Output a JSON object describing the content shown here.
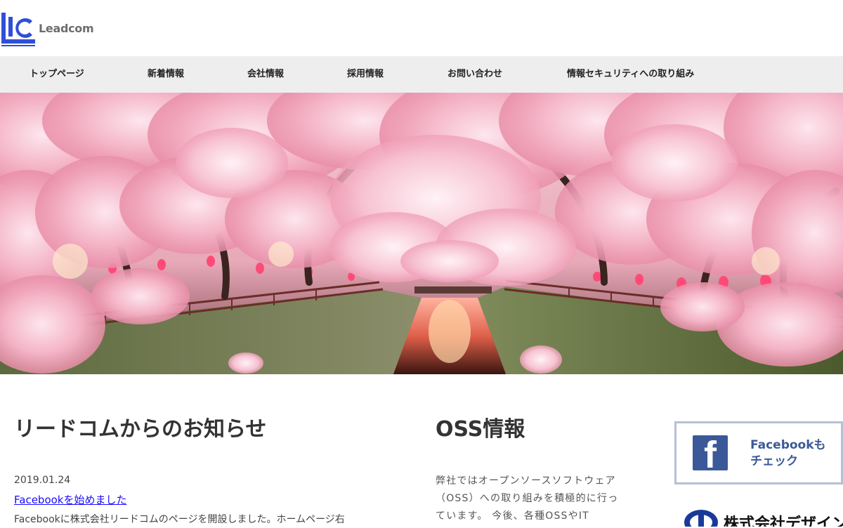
{
  "header": {
    "logo_text": "Leadcom"
  },
  "nav": {
    "items": [
      {
        "label": "トップページ"
      },
      {
        "label": "新着情報"
      },
      {
        "label": "会社情報"
      },
      {
        "label": "採用情報"
      },
      {
        "label": "お問い合わせ"
      },
      {
        "label": "情報セキュリティへの取り組み"
      }
    ]
  },
  "news": {
    "title": "リードコムからのお知らせ",
    "items": [
      {
        "date": "2019.01.24",
        "link": "Facebookを始めました",
        "body": "Facebookに株式会社リードコムのページを開設しました。ホームページ右"
      }
    ]
  },
  "oss": {
    "title": "OSS情報",
    "body": "弊社ではオープンソースソフトウェア（OSS）への取り組みを積極的に行っています。 今後、各種OSSやIT"
  },
  "sidebar": {
    "facebook_banner": {
      "line1": "Facebookも",
      "line2": "チェック",
      "icon": "facebook-icon"
    },
    "partner_banner": {
      "text": "株式会社デザイン"
    }
  },
  "colors": {
    "nav_background": "#eeeeee",
    "link": "#1a0dff",
    "facebook_blue": "#3b5998",
    "banner_border": "#b6c0d6",
    "logo_blue": "#2f4fd8"
  }
}
